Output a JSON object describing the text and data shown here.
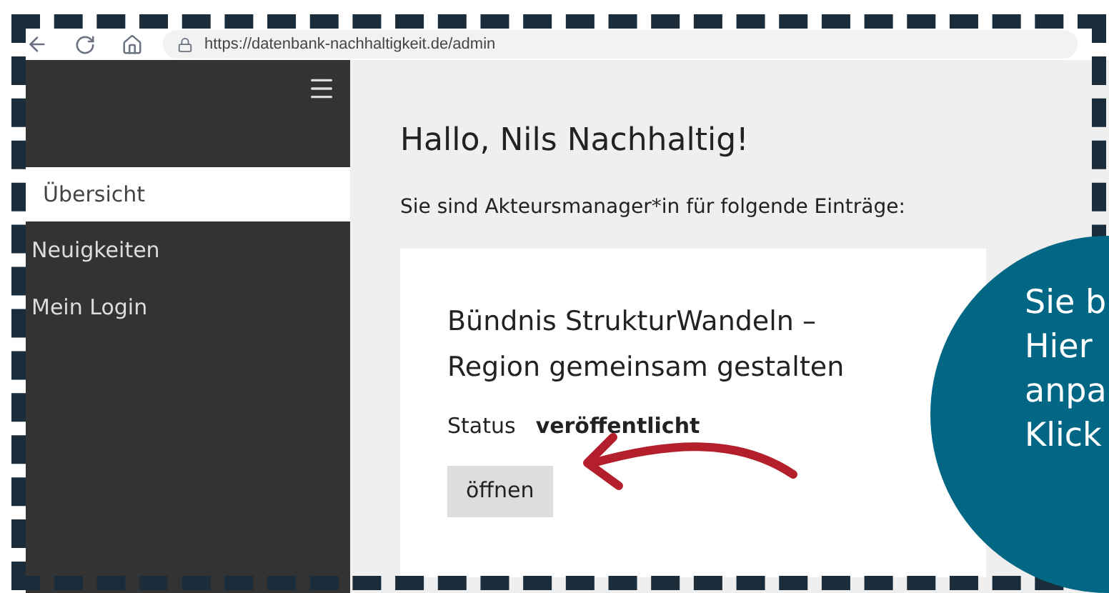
{
  "browser": {
    "url": "https://datenbank-nachhaltigkeit.de/admin"
  },
  "sidebar": {
    "items": [
      {
        "label": "Übersicht",
        "selected": true
      },
      {
        "label": "Neuigkeiten",
        "selected": false
      },
      {
        "label": "Mein Login",
        "selected": false
      }
    ]
  },
  "main": {
    "heading": "Hallo, Nils Nachhaltig!",
    "intro": "Sie sind Akteursmanager*in für folgende Einträge:",
    "entries": [
      {
        "title": "Bündnis StrukturWandeln – Region gemeinsam gestalten",
        "status_label": "Status",
        "status_value": "veröffentlicht",
        "button": "öffnen"
      }
    ]
  },
  "callout": {
    "lines": [
      "Sie b",
      "Hier",
      "anpa",
      "Klick"
    ]
  }
}
